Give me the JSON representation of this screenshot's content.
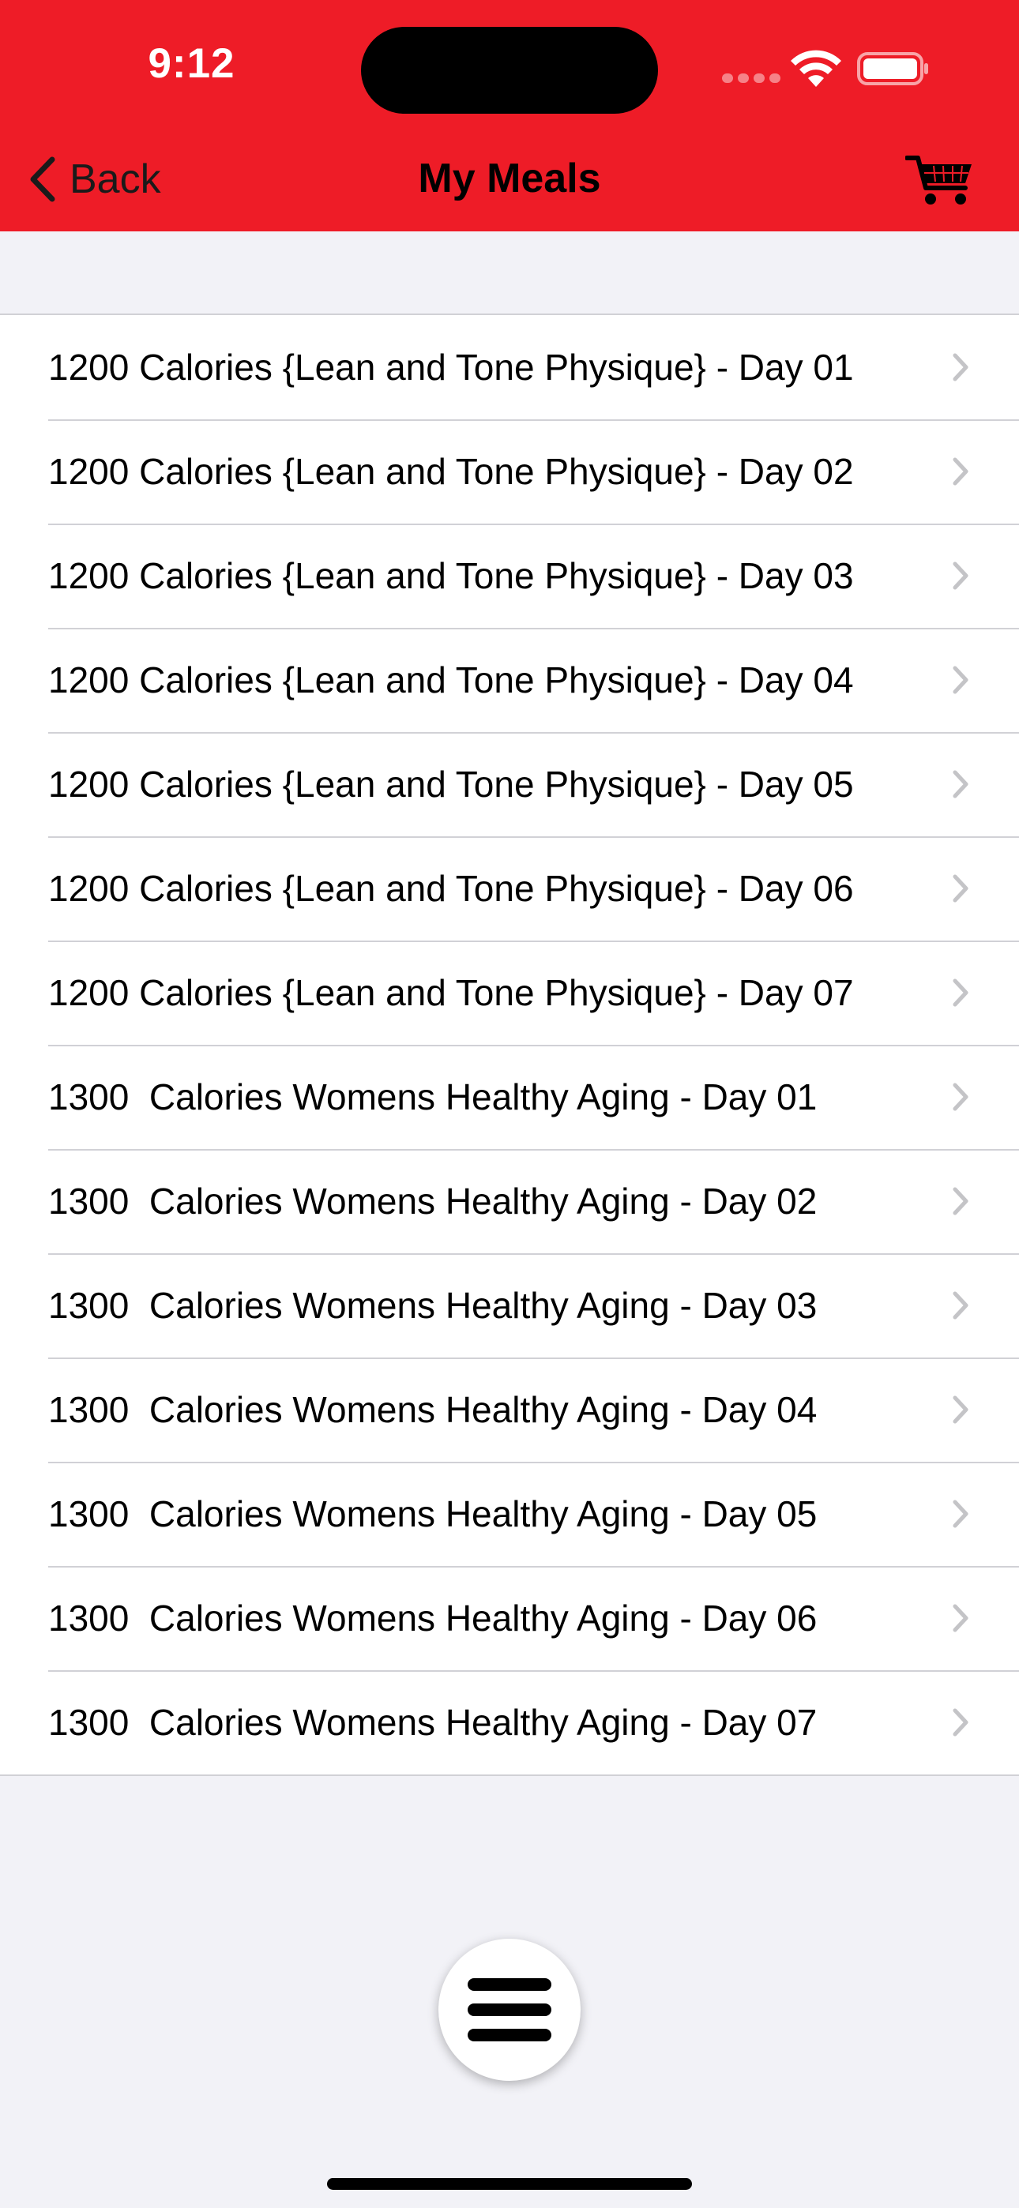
{
  "status_bar": {
    "time": "9:12"
  },
  "nav": {
    "back_label": "Back",
    "title": "My Meals",
    "cart_icon": "cart-icon",
    "accent_color": "#ee1c27"
  },
  "meals": [
    "1200 Calories {Lean and Tone Physique} - Day 01",
    "1200 Calories {Lean and Tone Physique} - Day 02",
    "1200 Calories {Lean and Tone Physique} - Day 03",
    "1200 Calories {Lean and Tone Physique} - Day 04",
    "1200 Calories {Lean and Tone Physique} - Day 05",
    "1200 Calories {Lean and Tone Physique} - Day 06",
    "1200 Calories {Lean and Tone Physique} - Day 07",
    "1300  Calories Womens Healthy Aging - Day 01",
    "1300  Calories Womens Healthy Aging - Day 02",
    "1300  Calories Womens Healthy Aging - Day 03",
    "1300  Calories Womens Healthy Aging - Day 04",
    "1300  Calories Womens Healthy Aging - Day 05",
    "1300  Calories Womens Healthy Aging - Day 06",
    "1300  Calories Womens Healthy Aging - Day 07"
  ],
  "fab": {
    "icon": "hamburger-menu-icon"
  }
}
